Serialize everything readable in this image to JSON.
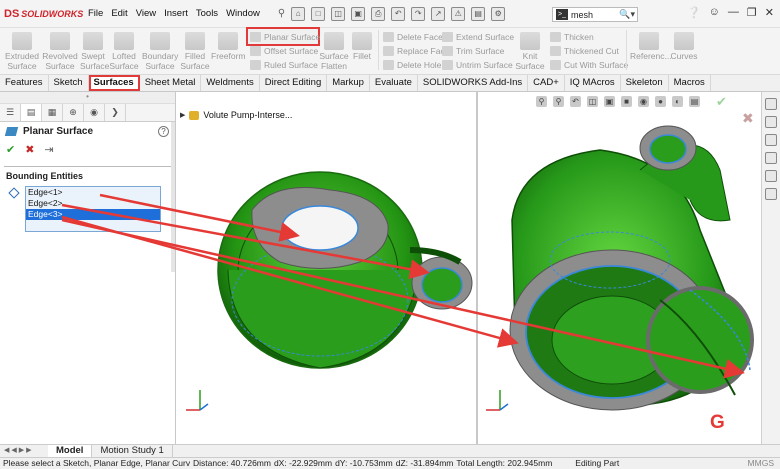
{
  "app": {
    "logo_mark": "DS",
    "logo_name": "SOLIDWORKS"
  },
  "menu": [
    "File",
    "Edit",
    "View",
    "Insert",
    "Tools",
    "Window"
  ],
  "search": {
    "value": "mesh"
  },
  "ribbon": {
    "extruded_surface": "Extruded Surface",
    "revolved_surface": "Revolved Surface",
    "swept_surface": "Swept Surface",
    "lofted_surface": "Lofted Surface",
    "boundary_surface": "Boundary Surface",
    "filled_surface": "Filled Surface",
    "freeform": "Freeform",
    "planar_surface": "Planar Surface",
    "offset_surface": "Offset Surface",
    "ruled_surface": "Ruled Surface",
    "surface_flatten": "Surface Flatten",
    "fillet": "Fillet",
    "delete_face": "Delete Face",
    "replace_face": "Replace Face",
    "delete_hole": "Delete Hole",
    "extend_surface": "Extend Surface",
    "trim_surface": "Trim Surface",
    "untrim_surface": "Untrim Surface",
    "knit_surface": "Knit Surface",
    "thicken": "Thicken",
    "thickened_cut": "Thickened Cut",
    "cut_with_surface": "Cut With Surface",
    "reference": "Referenc...",
    "curves": "Curves"
  },
  "tabs": [
    "Features",
    "Sketch",
    "Surfaces",
    "Sheet Metal",
    "Weldments",
    "Direct Editing",
    "Markup",
    "Evaluate",
    "SOLIDWORKS Add-Ins",
    "CAD+",
    "IQ MAcros",
    "Skeleton",
    "Macros"
  ],
  "property_manager": {
    "title": "Planar Surface",
    "help": "?",
    "section": "Bounding Entities",
    "edges": [
      "Edge<1>",
      "Edge<2>",
      "Edge<3>"
    ],
    "selected_index": 2
  },
  "viewport": {
    "tree_item": "Volute Pump-Interse...",
    "callout": "G"
  },
  "bottom_tabs": [
    "Model",
    "Motion Study 1"
  ],
  "status": {
    "prompt": "Please select a Sketch, Planar Edge, Planar Curve...",
    "distance": "Distance: 40.726mm",
    "dx": "dX: -22.929mm",
    "dy": "dY: -10.753mm",
    "dz": "dZ: -31.894mm",
    "total": "Total Length: 202.945mm",
    "mode": "Editing Part",
    "units": "MMGS"
  },
  "colors": {
    "accent_red": "#e03a3a",
    "model_green": "#2e9e1f",
    "flange_gray": "#8d8d8d",
    "selection_blue": "#1e6fd9"
  }
}
